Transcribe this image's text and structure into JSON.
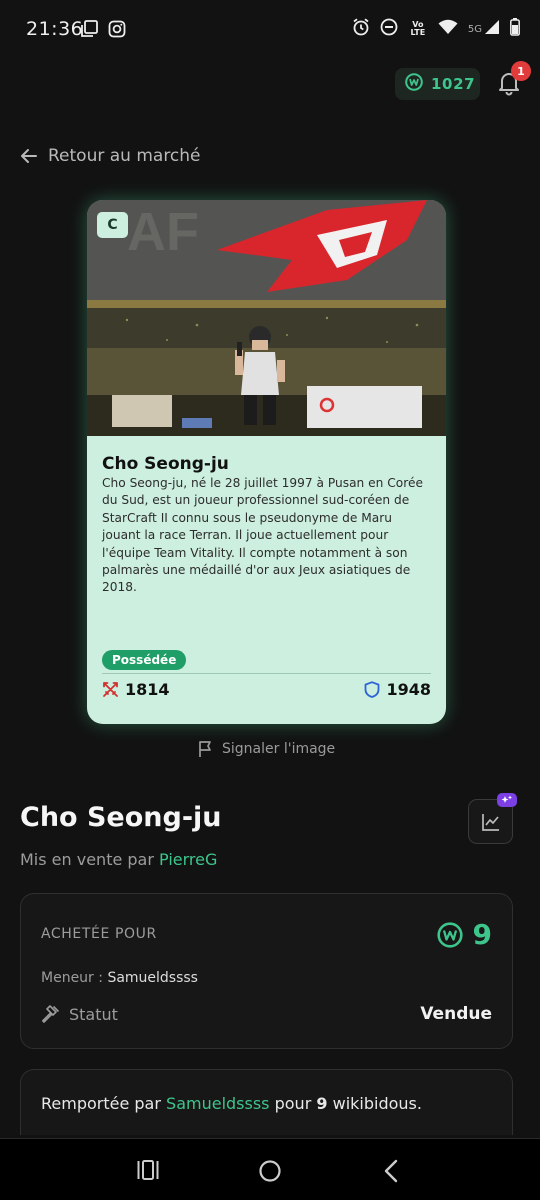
{
  "status_bar": {
    "time": "21:36",
    "icons": [
      "gallery-icon",
      "instagram-icon",
      "alarm-icon",
      "dnd-icon",
      "volte-icon",
      "wifi-icon",
      "5g-icon",
      "signal-icon",
      "battery-icon"
    ],
    "network_label": "5G",
    "volte_label": "Vo LTE"
  },
  "header": {
    "wallet_amount": "1027",
    "notification_count": "1"
  },
  "back_link": {
    "label": "Retour au marché"
  },
  "card": {
    "rarity": "C",
    "name": "Cho Seong-ju",
    "description": "Cho Seong-ju, né le 28 juillet 1997 à Pusan en Corée du Sud, est un joueur professionnel sud-coréen de StarCraft II connu sous le pseudonyme de Maru jouant la race Terran. Il joue actuellement pour l'équipe Team Vitality. Il compte notamment à son palmarès une médaillé d'or aux Jeux asiatiques de 2018.",
    "owned_badge": "Possédée",
    "attack": "1814",
    "defense": "1948"
  },
  "report_link": {
    "label": "Signaler l'image"
  },
  "listing": {
    "title": "Cho Seong-ju",
    "seller_prefix": "Mis en vente par",
    "seller_name": "PierreG"
  },
  "purchase_panel": {
    "bought_label": "ACHETÉE POUR",
    "price": "9",
    "leader_label": "Meneur :",
    "leader_name": "Samueldssss",
    "status_label": "Statut",
    "status_value": "Vendue"
  },
  "won_panel": {
    "prefix": "Remportée par",
    "winner": "Samueldssss",
    "middle": "pour",
    "amount": "9",
    "suffix": "wikibidous."
  },
  "colors": {
    "accent_green": "#3ec58c",
    "card_bg": "#cdefdf",
    "badge_red": "#e23b3b",
    "badge_purple": "#7b3fe4"
  }
}
